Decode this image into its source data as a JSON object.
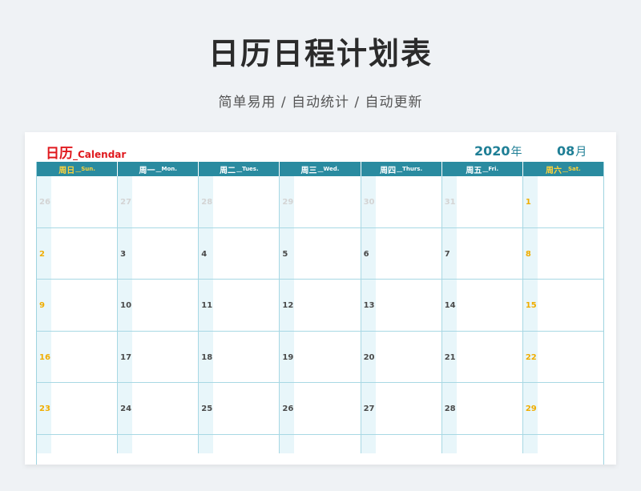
{
  "page": {
    "title": "日历日程计划表",
    "subtitle": "简单易用  /  自动统计  /  自动更新"
  },
  "calendar": {
    "label_cn": "日历",
    "label_en": "_Calendar",
    "year": "2020",
    "year_unit": "年",
    "month": "08",
    "month_unit": "月",
    "colors": {
      "header": "#2a8ba0",
      "weekend": "#f0ad00",
      "label": "#e0191e",
      "accent": "#1f7f96"
    },
    "weekdays": [
      {
        "cn": "周日",
        "en": "__Sun.",
        "weekend": true
      },
      {
        "cn": "周一",
        "en": "__Mon.",
        "weekend": false
      },
      {
        "cn": "周二",
        "en": "__Tues.",
        "weekend": false
      },
      {
        "cn": "周三",
        "en": "__Wed.",
        "weekend": false
      },
      {
        "cn": "周四",
        "en": "__Thurs.",
        "weekend": false
      },
      {
        "cn": "周五",
        "en": "__Fri.",
        "weekend": false
      },
      {
        "cn": "周六",
        "en": "__Sat.",
        "weekend": true
      }
    ],
    "weeks": [
      [
        {
          "day": "26",
          "state": "faded"
        },
        {
          "day": "27",
          "state": "faded"
        },
        {
          "day": "28",
          "state": "faded"
        },
        {
          "day": "29",
          "state": "faded"
        },
        {
          "day": "30",
          "state": "faded"
        },
        {
          "day": "31",
          "state": "faded"
        },
        {
          "day": "1",
          "state": "weekend"
        }
      ],
      [
        {
          "day": "2",
          "state": "weekend"
        },
        {
          "day": "3",
          "state": "normal"
        },
        {
          "day": "4",
          "state": "normal"
        },
        {
          "day": "5",
          "state": "normal"
        },
        {
          "day": "6",
          "state": "normal"
        },
        {
          "day": "7",
          "state": "normal"
        },
        {
          "day": "8",
          "state": "weekend"
        }
      ],
      [
        {
          "day": "9",
          "state": "weekend"
        },
        {
          "day": "10",
          "state": "normal"
        },
        {
          "day": "11",
          "state": "normal"
        },
        {
          "day": "12",
          "state": "normal"
        },
        {
          "day": "13",
          "state": "normal"
        },
        {
          "day": "14",
          "state": "normal"
        },
        {
          "day": "15",
          "state": "weekend"
        }
      ],
      [
        {
          "day": "16",
          "state": "weekend"
        },
        {
          "day": "17",
          "state": "normal"
        },
        {
          "day": "18",
          "state": "normal"
        },
        {
          "day": "19",
          "state": "normal"
        },
        {
          "day": "20",
          "state": "normal"
        },
        {
          "day": "21",
          "state": "normal"
        },
        {
          "day": "22",
          "state": "weekend"
        }
      ],
      [
        {
          "day": "23",
          "state": "weekend"
        },
        {
          "day": "24",
          "state": "normal"
        },
        {
          "day": "25",
          "state": "normal"
        },
        {
          "day": "26",
          "state": "normal"
        },
        {
          "day": "27",
          "state": "normal"
        },
        {
          "day": "28",
          "state": "normal"
        },
        {
          "day": "29",
          "state": "weekend"
        }
      ]
    ]
  }
}
